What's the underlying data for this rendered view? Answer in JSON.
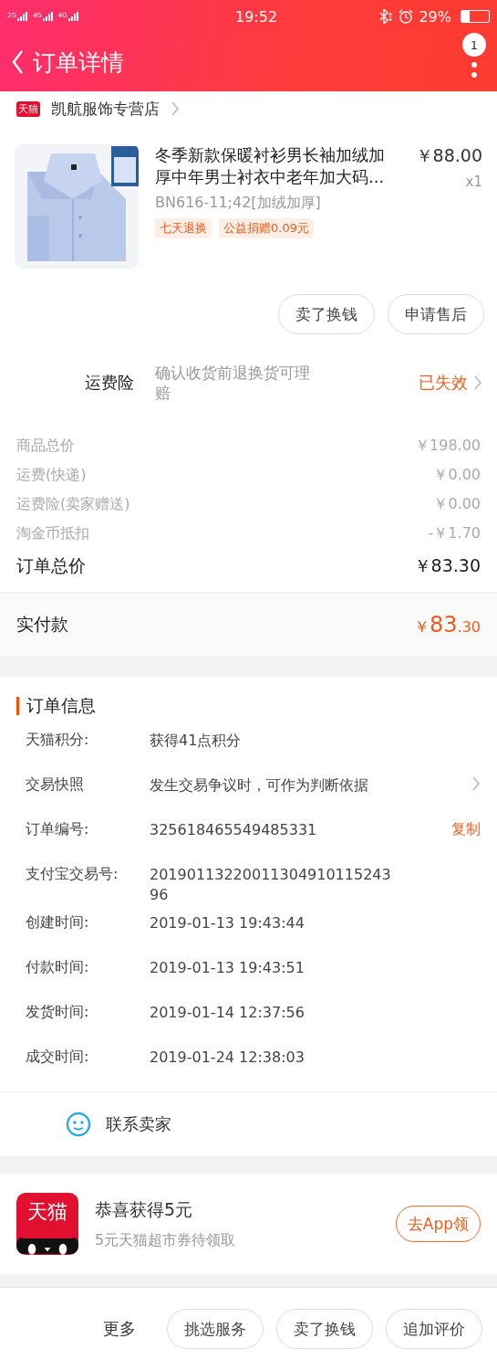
{
  "status_bar": {
    "signal_labels": [
      "2G",
      "4G",
      "4G"
    ],
    "time": "19:52",
    "battery_percent": "29%"
  },
  "header": {
    "title": "订单详情",
    "badge": "1"
  },
  "shop": {
    "badge": "天猫",
    "name": "凯航服饰专营店"
  },
  "product": {
    "image": {
      "kind": "picture"
    },
    "title": "冬季新款保暖衬衫男长袖加绒加厚中年男士衬衣中老年加大码...",
    "price": "￥88.00",
    "quantity": "x1",
    "sku": "BN616-11;42[加绒加厚]",
    "tags": [
      "七天退换",
      "公益捐赠0.09元"
    ]
  },
  "item_buttons": [
    "卖了换钱",
    "申请售后"
  ],
  "insurance": {
    "label": "运费险",
    "description": "确认收货前退换货可理赔",
    "status": "已失效"
  },
  "price_rows": [
    {
      "label": "商品总价",
      "value": "￥198.00",
      "kind": "minor"
    },
    {
      "label": "运费(快递)",
      "value": "￥0.00",
      "kind": "minor"
    },
    {
      "label": "运费险(卖家赠送)",
      "value": "￥0.00",
      "kind": "minor"
    },
    {
      "label": "淘金币抵扣",
      "value": "-￥1.70",
      "kind": "minor"
    },
    {
      "label": "订单总价",
      "value": "￥83.30",
      "kind": "total"
    }
  ],
  "paid": {
    "label": "实付款",
    "amount": "￥83.30"
  },
  "order_info": {
    "title": "订单信息",
    "rows": [
      {
        "label": "天猫积分:",
        "value": "获得41点积分"
      },
      {
        "label": "交易快照",
        "value": "发生交易争议时，可作为判断依据",
        "chevron": true
      },
      {
        "label": "订单编号:",
        "value": "325618465549485331",
        "action": "复制"
      },
      {
        "label": "支付宝交易号:",
        "value": "2019011322001130491011524396"
      },
      {
        "label": "创建时间:",
        "value": "2019-01-13 19:43:44"
      },
      {
        "label": "付款时间:",
        "value": "2019-01-13 19:43:51"
      },
      {
        "label": "发货时间:",
        "value": "2019-01-14 12:37:56"
      },
      {
        "label": "成交时间:",
        "value": "2019-01-24 12:38:03"
      }
    ]
  },
  "contact": {
    "label": "联系卖家"
  },
  "promo": {
    "logo": "天猫",
    "title": "恭喜获得5元",
    "subtitle": "5元天猫超市券待领取",
    "button": "去App领"
  },
  "bottom_bar": {
    "more": "更多",
    "buttons": [
      "挑选服务",
      "卖了换钱",
      "追加评价"
    ]
  }
}
